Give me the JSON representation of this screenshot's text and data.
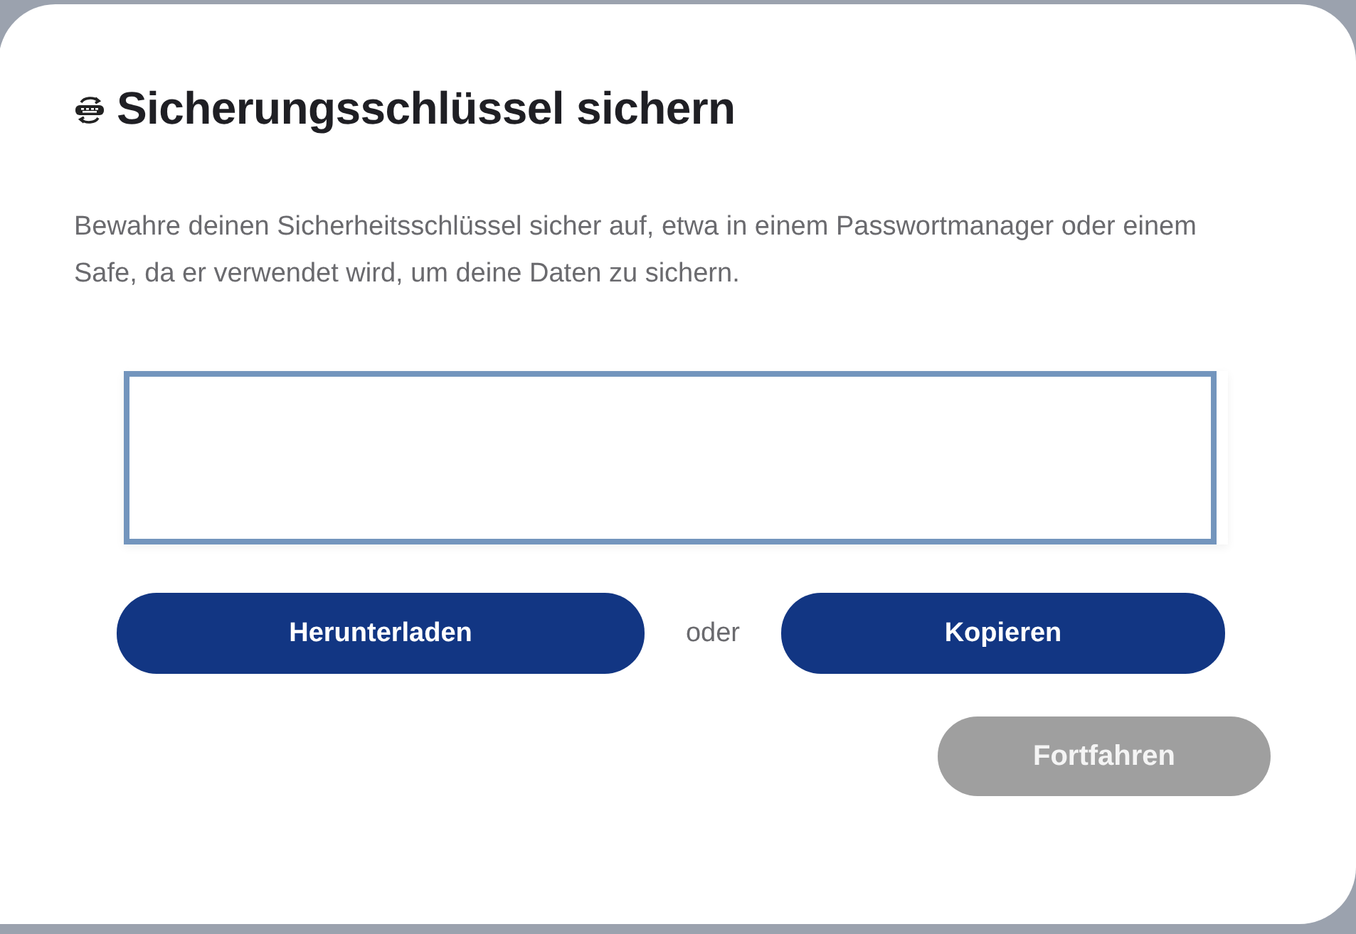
{
  "dialog": {
    "title": "Sicherungsschlüssel sichern",
    "description": "Bewahre deinen Sicherheitsschlüssel sicher auf, etwa in einem Passwortmanager oder einem Safe, da er verwendet wird, um deine Daten zu sichern.",
    "key_field": {
      "focused": true
    },
    "actions": [
      {
        "kind": "button",
        "label": "Herunterladen"
      },
      {
        "kind": "separator",
        "label": "oder"
      },
      {
        "kind": "button",
        "label": "Kopieren"
      }
    ],
    "continue_button": {
      "label": "Fortfahren",
      "disabled": true
    }
  }
}
